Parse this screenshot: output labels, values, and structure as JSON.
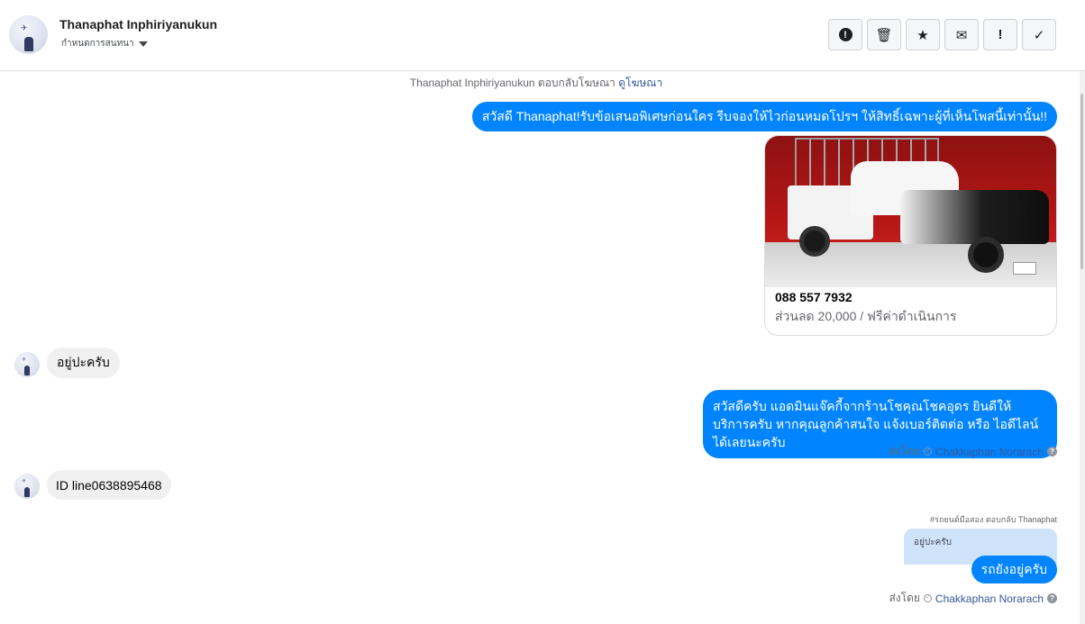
{
  "header": {
    "name": "Thanaphat Inphiriyanukun",
    "assign_label": "กำหนดการสนทนา",
    "toolbar": [
      {
        "icon": "alert-circle-icon",
        "glyph": "!"
      },
      {
        "icon": "trash-icon",
        "glyph": "🗑"
      },
      {
        "icon": "star-icon",
        "glyph": "★"
      },
      {
        "icon": "envelope-icon",
        "glyph": "✉"
      },
      {
        "icon": "exclamation-icon",
        "glyph": "!"
      },
      {
        "icon": "check-icon",
        "glyph": "✓"
      }
    ]
  },
  "ad_context": {
    "text": "Thanaphat Inphiriyanukun ตอบกลับโฆษณา",
    "link": "ดูโฆษณา"
  },
  "messages": {
    "m1": "สวัสดี Thanaphat!รับข้อเสนอพิเศษก่อนใคร รีบจองให้ไวก่อนหมดโปรฯ ให้สิทธิ์เฉพาะผู้ที่เห็นโพสนี้เท่านั้น!!",
    "card": {
      "title": "088 557 7932",
      "subtitle": "ส่วนลด 20,000 / ฟรีค่าดำเนินการ"
    },
    "m2": "อยู่ปะครับ",
    "m3": "สวัสดีครับ แอดมินแจ๊คกี้จากร้านโชคุณโชคอุดร ยินดีให้บริการครับ หากคุณลูกค้าสนใจ แจ้งเบอร์ติดต่อ หรือ ไอดีไลน์ ได้เลยนะครับ",
    "m3_sent_by_label": "ส่งโดย",
    "m3_sender": "Chakkaphan Norarach",
    "m4": "ID line0638895468",
    "m5_reply_header": "#รถยนต์มือสอง ตอบกลับ Thanaphat",
    "m5_quoted": "อยู่ปะครับ",
    "m5": "รถยังอยู่ครับ",
    "m5_sent_by_label": "ส่งโดย",
    "m5_sender": "Chakkaphan Norarach"
  },
  "colors": {
    "outgoing_bubble": "#0084ff",
    "incoming_bubble": "#f0f0f0",
    "quoted_bubble": "#cfe3fb",
    "link": "#385898"
  }
}
